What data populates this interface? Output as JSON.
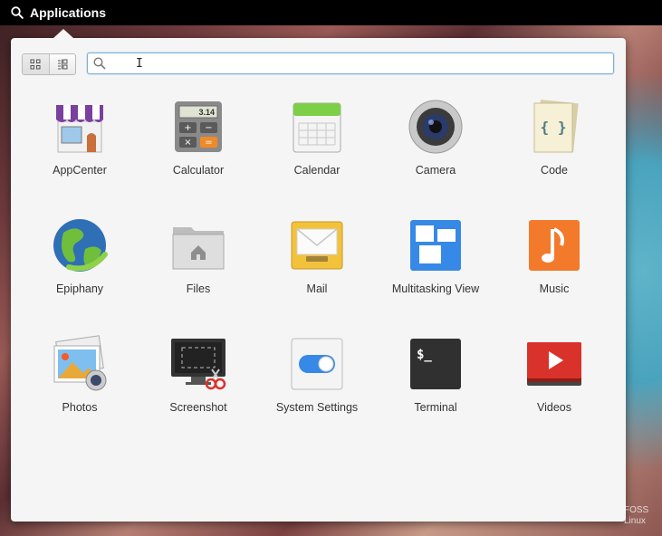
{
  "panel": {
    "title": "Applications"
  },
  "launcher": {
    "search_placeholder": "",
    "search_value": "",
    "view_modes": [
      "grid",
      "category"
    ],
    "apps": [
      {
        "label": "AppCenter",
        "icon": "appcenter-icon"
      },
      {
        "label": "Calculator",
        "icon": "calculator-icon"
      },
      {
        "label": "Calendar",
        "icon": "calendar-icon"
      },
      {
        "label": "Camera",
        "icon": "camera-icon"
      },
      {
        "label": "Code",
        "icon": "code-icon"
      },
      {
        "label": "Epiphany",
        "icon": "epiphany-icon"
      },
      {
        "label": "Files",
        "icon": "files-icon"
      },
      {
        "label": "Mail",
        "icon": "mail-icon"
      },
      {
        "label": "Multitasking View",
        "icon": "multitasking-icon"
      },
      {
        "label": "Music",
        "icon": "music-icon"
      },
      {
        "label": "Photos",
        "icon": "photos-icon"
      },
      {
        "label": "Screenshot",
        "icon": "screenshot-icon"
      },
      {
        "label": "System Settings",
        "icon": "settings-icon"
      },
      {
        "label": "Terminal",
        "icon": "terminal-icon"
      },
      {
        "label": "Videos",
        "icon": "videos-icon"
      }
    ],
    "calculator_display": "3.14",
    "terminal_prompt": "$_"
  },
  "watermark": {
    "line1": "FOSS",
    "line2": "Linux"
  },
  "colors": {
    "panel_bg": "#000000",
    "popover_bg": "#f5f5f5",
    "search_focus": "#7fb0d8"
  }
}
